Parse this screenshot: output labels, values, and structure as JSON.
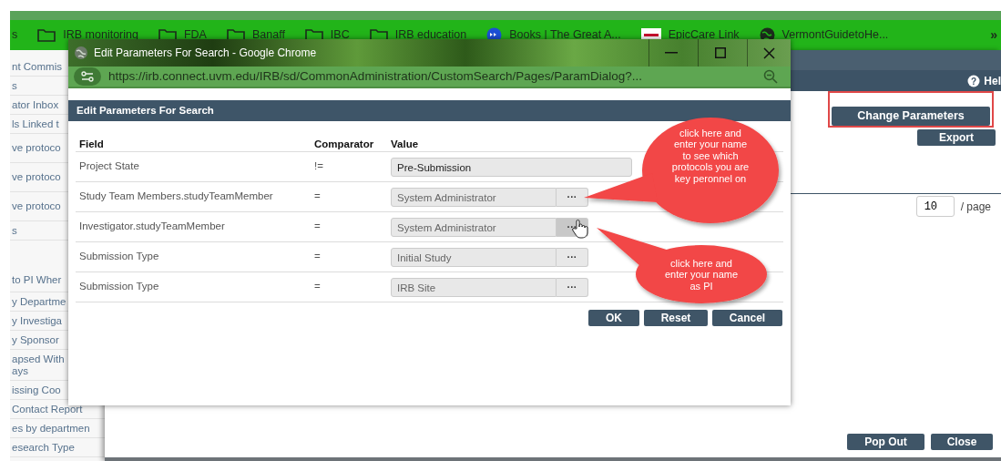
{
  "browser": {
    "bookmarks": [
      {
        "label": "s",
        "kind": "text"
      },
      {
        "label": "IRB monitoring",
        "kind": "folder"
      },
      {
        "label": "FDA",
        "kind": "folder"
      },
      {
        "label": "Banaff",
        "kind": "folder"
      },
      {
        "label": "IBC",
        "kind": "folder"
      },
      {
        "label": "IRB education",
        "kind": "folder"
      },
      {
        "label": "Books | The Great A...",
        "kind": "books"
      },
      {
        "label": "EpicCare Link",
        "kind": "epic"
      },
      {
        "label": "VermontGuidetoHe...",
        "kind": "globe"
      }
    ],
    "overflow": "»"
  },
  "sidebar": {
    "items": [
      "nt Commis",
      "s",
      "ator Inbox",
      "ls Linked t",
      "ve protoco",
      "ve protoco",
      "ve protoco",
      "s",
      "to PI Wher",
      "y Departme",
      "y Investiga",
      "y Sponsor",
      "apsed With\nays",
      "issing Coo",
      "Contact Report",
      "es by departmen",
      "esearch Type"
    ]
  },
  "page": {
    "help_icon": "?",
    "help": "Hel",
    "change_parameters": "Change Parameters",
    "export": "Export",
    "per_page_value": "10",
    "per_page_label": "/ page",
    "buttons": [
      "Pop Out",
      "Close"
    ]
  },
  "dialog": {
    "window_title": "Edit Parameters For Search - Google Chrome",
    "url": "https://irb.connect.uvm.edu/IRB/sd/CommonAdministration/CustomSearch/Pages/ParamDialog?...",
    "header": "Edit Parameters For Search",
    "columns": [
      "Field",
      "Comparator",
      "Value"
    ],
    "rows": [
      {
        "field": "Project State",
        "comparator": "!=",
        "value": "Pre-Submission",
        "kind": "select"
      },
      {
        "field": "Study Team Members.studyTeamMember",
        "comparator": "=",
        "value": "System Administrator",
        "kind": "lookup",
        "button": "···",
        "hovered": false
      },
      {
        "field": "Investigator.studyTeamMember",
        "comparator": "=",
        "value": "System Administrator",
        "kind": "lookup",
        "button": "···",
        "hovered": true
      },
      {
        "field": "Submission Type",
        "comparator": "=",
        "value": "Initial Study",
        "kind": "lookup",
        "button": "···",
        "hovered": false
      },
      {
        "field": "Submission Type",
        "comparator": "=",
        "value": "IRB Site",
        "kind": "lookup",
        "button": "···",
        "hovered": false
      }
    ],
    "buttons": [
      "OK",
      "Reset",
      "Cancel"
    ]
  },
  "callouts": [
    {
      "text": "click here and enter your name to see which protocols you are key peronnel on"
    },
    {
      "text": "click here and enter your name as PI"
    }
  ]
}
